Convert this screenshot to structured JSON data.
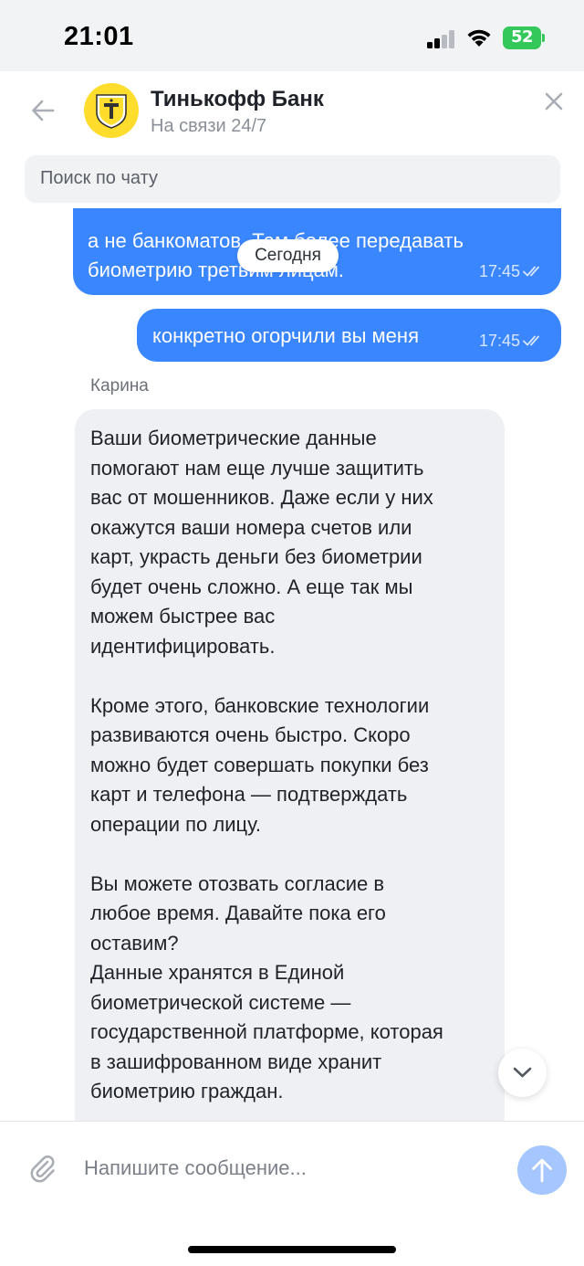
{
  "status_bar": {
    "time": "21:01",
    "battery_level": "52",
    "battery_color": "#34c759"
  },
  "header": {
    "bank_name": "Тинькофф Банк",
    "status": "На связи 24/7",
    "back_icon": "arrow-left-icon",
    "close_icon": "close-icon",
    "avatar_color": "#ffdd2d"
  },
  "search": {
    "placeholder": "Поиск по чату"
  },
  "messages": {
    "date_divider": "Сегодня",
    "outgoing": [
      {
        "lines": [
          "а не банкоматов. Там более передавать",
          "биометрию третьим лицам."
        ],
        "time": "17:45"
      },
      {
        "lines": [
          "конкретно огорчили вы меня"
        ],
        "time": "17:45"
      }
    ],
    "incoming": {
      "sender": "Карина",
      "lines": [
        "Ваши биометрические данные",
        "помогают нам еще лучше защитить",
        "вас от мошенников. Даже если у них",
        "окажутся ваши номера счетов или",
        "карт, украсть деньги без биометрии",
        "будет очень сложно. А еще так мы",
        "можем быстрее вас",
        "идентифицировать.",
        "",
        "Кроме этого, банковские технологии",
        "развиваются очень быстро. Скоро",
        "можно будет совершать покупки без",
        "карт и телефона — подтверждать",
        "операции по лицу.",
        "",
        "Вы можете отозвать согласие в",
        "любое время. Давайте пока его",
        "оставим?",
        "Данные хранятся в Единой",
        "биометрической системе —",
        "государственной платформе, которая",
        "в зашифрованном виде хранит",
        "биометрию граждан."
      ]
    },
    "outgoing_color": "#3a86ff",
    "incoming_color": "#eef0f4"
  },
  "composer": {
    "placeholder": "Напишите сообщение...",
    "attach_icon": "paperclip-icon",
    "send_icon": "arrow-up-icon",
    "send_color": "#a5c6ff"
  },
  "scroll_button": {
    "icon": "chevron-down-icon"
  }
}
